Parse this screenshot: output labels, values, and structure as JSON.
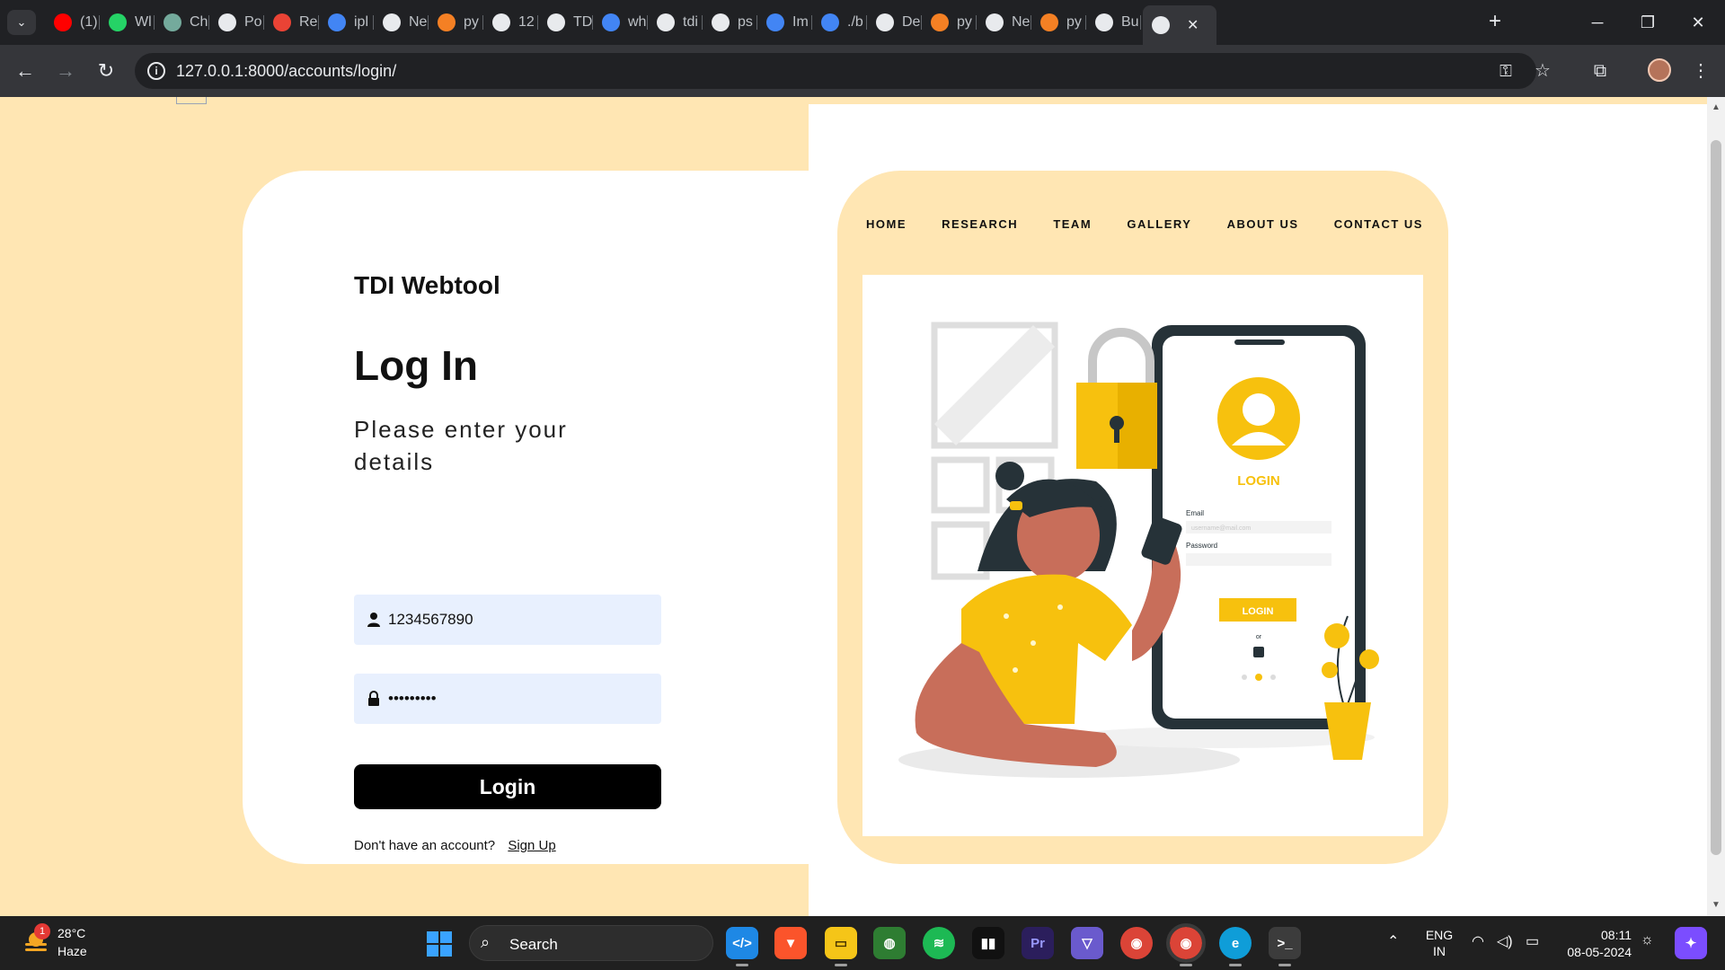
{
  "browser": {
    "tabs": [
      {
        "label": "(1)",
        "icon": "youtube-icon",
        "color": "#ff0000"
      },
      {
        "label": "Wl",
        "icon": "whatsapp-icon",
        "color": "#25d366"
      },
      {
        "label": "Ch",
        "icon": "chatgpt-icon",
        "color": "#74aa9c"
      },
      {
        "label": "Po",
        "icon": "globe-icon",
        "color": "#e8eaed"
      },
      {
        "label": "Re",
        "icon": "gmail-icon",
        "color": "#ea4335"
      },
      {
        "label": "ipl",
        "icon": "google-icon",
        "color": "#4285f4"
      },
      {
        "label": "Ne",
        "icon": "chatgpt-icon",
        "color": "#e8eaed"
      },
      {
        "label": "py",
        "icon": "stackoverflow-icon",
        "color": "#f48024"
      },
      {
        "label": "12",
        "icon": "globe-icon",
        "color": "#e8eaed"
      },
      {
        "label": "TD",
        "icon": "github-icon",
        "color": "#e8eaed"
      },
      {
        "label": "wh",
        "icon": "google-icon",
        "color": "#4285f4"
      },
      {
        "label": "tdi",
        "icon": "triangle-icon",
        "color": "#e8eaed"
      },
      {
        "label": "ps",
        "icon": "box-icon",
        "color": "#e8eaed"
      },
      {
        "label": "Im",
        "icon": "google-icon",
        "color": "#4285f4"
      },
      {
        "label": "./b",
        "icon": "google-icon",
        "color": "#4285f4"
      },
      {
        "label": "De",
        "icon": "medium-icon",
        "color": "#e8eaed"
      },
      {
        "label": "py",
        "icon": "stackoverflow-icon",
        "color": "#f48024"
      },
      {
        "label": "Ne",
        "icon": "chatgpt-icon",
        "color": "#e8eaed"
      },
      {
        "label": "py",
        "icon": "stackoverflow-icon",
        "color": "#f48024"
      },
      {
        "label": "Bu",
        "icon": "github-icon",
        "color": "#e8eaed"
      }
    ],
    "url": "127.0.0.1:8000/accounts/login/"
  },
  "page": {
    "brand": "TDI Webtool",
    "heading": "Log In",
    "subheading": "Please enter your details",
    "username_value": "1234567890",
    "password_value": "•••••••••",
    "login_label": "Login",
    "signup_prompt": "Don't have an account?",
    "signup_link": "Sign Up",
    "nav": [
      "HOME",
      "RESEARCH",
      "TEAM",
      "GALLERY",
      "ABOUT US",
      "CONTACT US"
    ],
    "illustration": {
      "login_label": "LOGIN",
      "email_label": "Email",
      "email_placeholder": "username@mail.com",
      "password_label": "Password",
      "button_label": "LOGIN",
      "or_label": "or"
    },
    "colors": {
      "accent": "#ffe6b3",
      "button": "#000000",
      "field": "#e8f0fe",
      "illustration_yellow": "#f7c10e"
    }
  },
  "taskbar": {
    "weather_badge": "1",
    "temperature": "28°C",
    "condition": "Haze",
    "search_label": "Search",
    "language": "ENG",
    "region": "IN",
    "time": "08:11",
    "date": "08-05-2024"
  }
}
